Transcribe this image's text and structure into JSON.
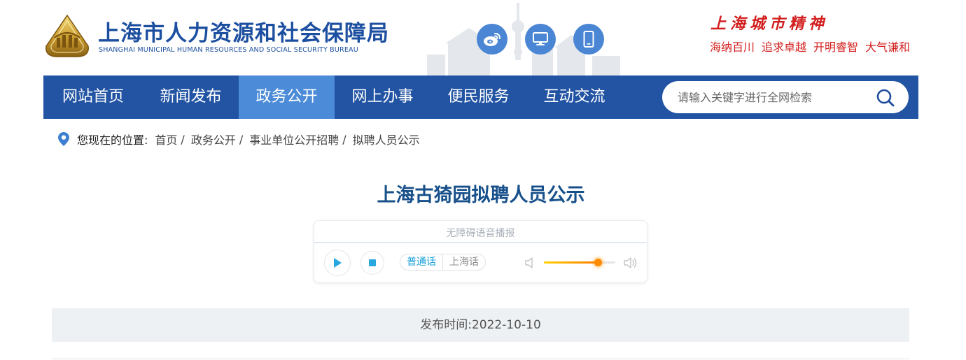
{
  "header": {
    "logo_cn": "上海市人力资源和社会保障局",
    "logo_en": "SHANGHAI MUNICIPAL HUMAN RESOURCES AND SOCIAL SECURITY BUREAU",
    "icons": [
      "weibo-icon",
      "desktop-icon",
      "mobile-icon"
    ],
    "spirit_title": "上海城市精神",
    "spirit_mottos": [
      "海纳百川",
      "追求卓越",
      "开明睿智",
      "大气谦和"
    ]
  },
  "nav": {
    "items": [
      "网站首页",
      "新闻发布",
      "政务公开",
      "网上办事",
      "便民服务",
      "互动交流"
    ],
    "active": "政务公开",
    "search_placeholder": "请输入关键字进行全网检索"
  },
  "breadcrumb": {
    "prefix": "您现在的位置:",
    "items": [
      "首页",
      "政务公开",
      "事业单位公开招聘"
    ],
    "current": "拟聘人员公示"
  },
  "article": {
    "title": "上海古猗园拟聘人员公示",
    "publish_time": "发布时间:2022-10-10"
  },
  "player": {
    "title": "无障碍语音播报",
    "lang_options": [
      "普通话",
      "上海话"
    ],
    "lang_selected": "普通话",
    "volume": 0.75
  },
  "colors": {
    "nav_bg": "#2254a3",
    "nav_active": "#4b8bd7",
    "title_blue": "#17508a",
    "spirit_red": "#d21e1e"
  }
}
